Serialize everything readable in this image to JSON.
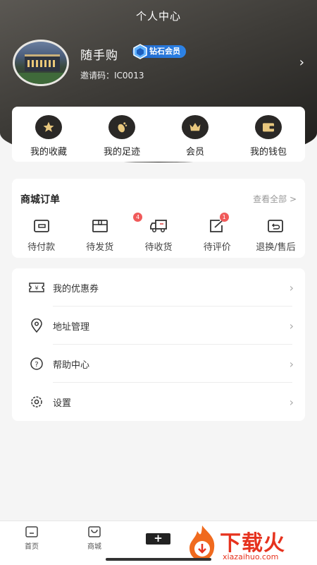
{
  "header": {
    "title": "个人中心"
  },
  "profile": {
    "name": "随手购",
    "badge": "钻石会员",
    "invite_code": "邀请码：IC0013"
  },
  "quick_links": [
    {
      "label": "我的收藏",
      "icon": "star-icon"
    },
    {
      "label": "我的足迹",
      "icon": "footprint-icon"
    },
    {
      "label": "会员",
      "icon": "crown-icon"
    },
    {
      "label": "我的钱包",
      "icon": "wallet-icon"
    }
  ],
  "orders": {
    "title": "商城订单",
    "view_all": "查看全部 >",
    "items": [
      {
        "label": "待付款",
        "icon": "card-icon",
        "badge": null
      },
      {
        "label": "待发货",
        "icon": "package-icon",
        "badge": "4"
      },
      {
        "label": "待收货",
        "icon": "truck-icon",
        "badge": null
      },
      {
        "label": "待评价",
        "icon": "edit-icon",
        "badge": "1"
      },
      {
        "label": "退换/售后",
        "icon": "return-icon",
        "badge": null
      }
    ]
  },
  "menu": [
    {
      "label": "我的优惠券",
      "icon": "coupon-icon"
    },
    {
      "label": "地址管理",
      "icon": "location-icon"
    },
    {
      "label": "帮助中心",
      "icon": "help-icon"
    },
    {
      "label": "设置",
      "icon": "settings-icon"
    }
  ],
  "tabbar": {
    "home": "首页",
    "mall": "商城",
    "plus": "+"
  },
  "watermark": {
    "text": "下载火",
    "sub": "xiazaihuo.com"
  },
  "colors": {
    "accent": "#e6321e",
    "badge_blue": "#2d84e8",
    "header_dark": "#3e3c38"
  }
}
